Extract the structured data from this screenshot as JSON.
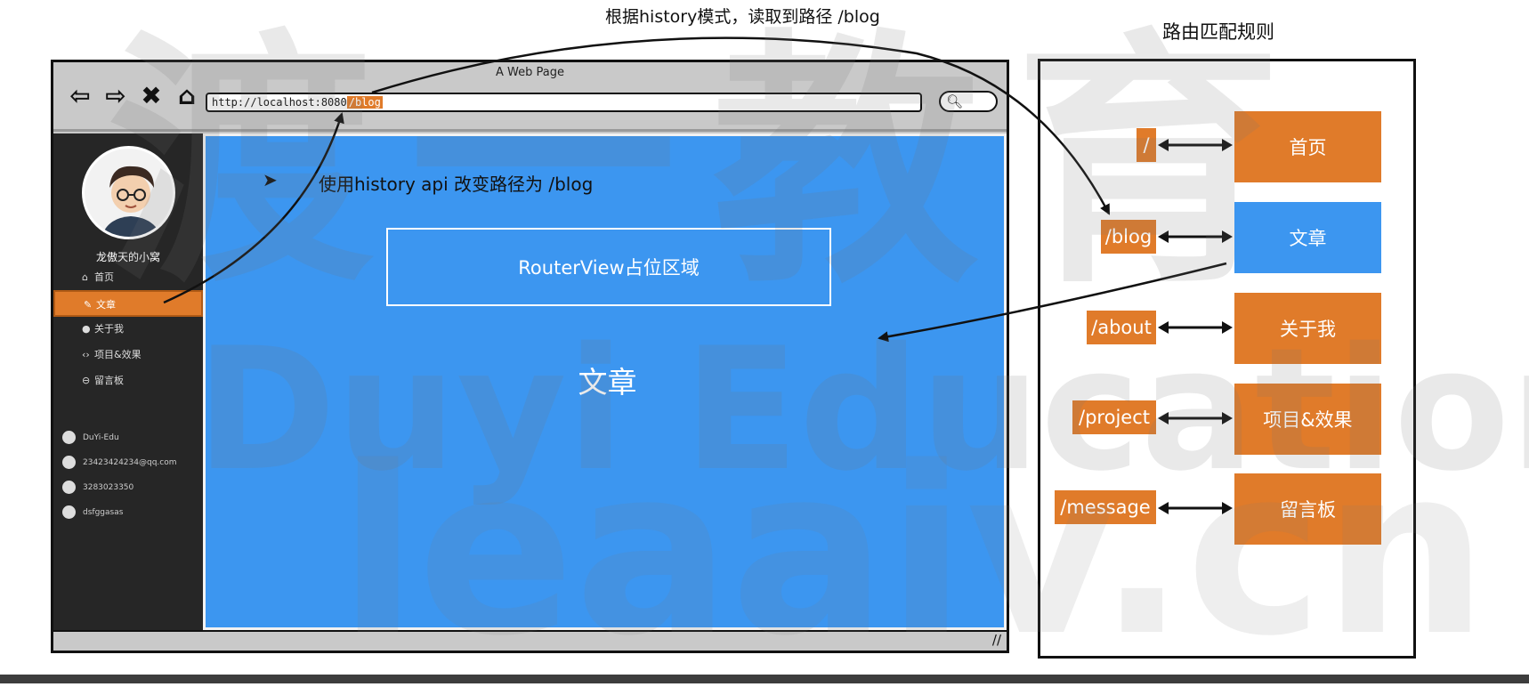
{
  "captions": {
    "top": "根据history模式，读取到路径 /blog",
    "rules_title": "路由匹配规则"
  },
  "browser": {
    "title": "A Web Page",
    "url_base": "http://localhost:8080",
    "url_path": "/blog",
    "nav_icons": [
      "back-arrow-icon",
      "forward-arrow-icon",
      "close-icon",
      "home-icon"
    ]
  },
  "sidebar": {
    "user_name": "龙傲天的小窝",
    "menu": [
      {
        "label": "首页",
        "icon": "home-icon"
      },
      {
        "label": "文章",
        "icon": "pen-icon",
        "active": true
      },
      {
        "label": "关于我",
        "icon": "info-icon"
      },
      {
        "label": "项目&效果",
        "icon": "code-icon"
      },
      {
        "label": "留言板",
        "icon": "message-icon"
      }
    ],
    "contacts": [
      {
        "text": "DuYi-Edu",
        "icon": "github-icon"
      },
      {
        "text": "23423424234@qq.com",
        "icon": "mail-icon"
      },
      {
        "text": "3283023350",
        "icon": "qq-icon"
      },
      {
        "text": "dsfggasas",
        "icon": "wechat-icon"
      }
    ]
  },
  "content": {
    "caption": "使用history api 改变路径为 /blog",
    "router_view": "RouterView占位区域",
    "page_text": "文章"
  },
  "rules": [
    {
      "path": "/",
      "page": "首页"
    },
    {
      "path": "/blog",
      "page": "文章",
      "current": true
    },
    {
      "path": "/about",
      "page": "关于我"
    },
    {
      "path": "/project",
      "page": "项目&效果"
    },
    {
      "path": "/message",
      "page": "留言板"
    }
  ],
  "watermark": {
    "top": "渡一教育",
    "mid": "Duyi Education",
    "low": "leaaiv.cn"
  },
  "colors": {
    "route_orange": "#e07b2a",
    "route_active_blue": "#3c96f0",
    "sidebar_dark": "#262626"
  }
}
